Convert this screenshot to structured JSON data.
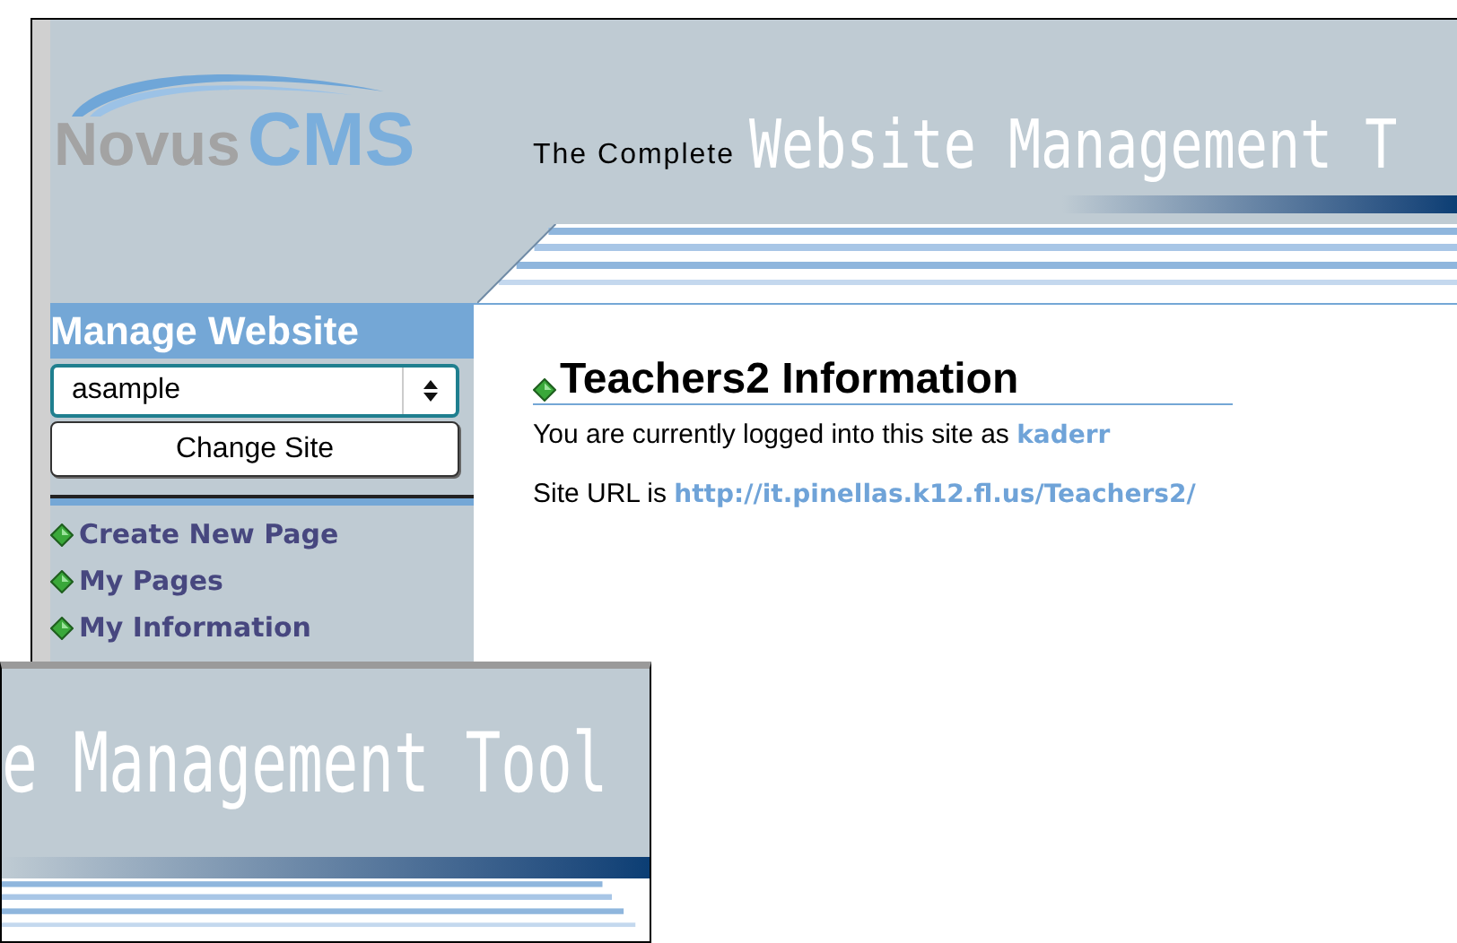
{
  "header": {
    "logo": {
      "word_1": "Novus",
      "word_2": "CMS"
    },
    "tagline": "The Complete",
    "tagline_big": "Website Management T"
  },
  "sidebar": {
    "title": "Manage Website",
    "site_select": {
      "value": "asample"
    },
    "change_button": "Change Site",
    "links": [
      "Create New Page",
      "My Pages",
      "My Information"
    ]
  },
  "content": {
    "title": "Teachers2 Information",
    "login_text": "You are currently logged into this site as",
    "user": "kaderr",
    "url_label": "Site URL is",
    "url": "http://it.pinellas.k12.fl.us/Teachers2/"
  },
  "zoom_inset": {
    "text": "e Management Tool"
  }
}
